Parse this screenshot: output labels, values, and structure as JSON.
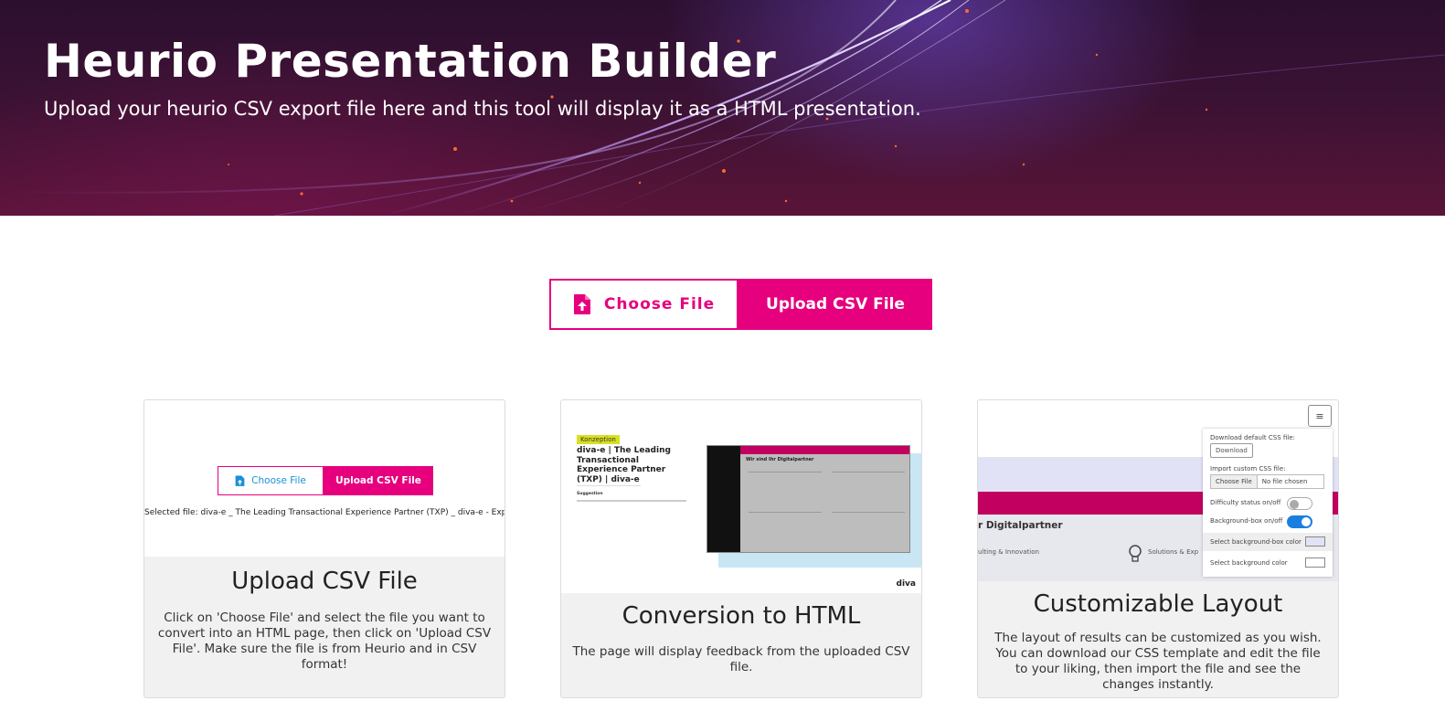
{
  "hero": {
    "title": "Heurio Presentation Builder",
    "subtitle": "Upload your heurio CSV export file here and this tool will display it as a HTML presentation."
  },
  "upload": {
    "choose_label": "Choose File",
    "upload_label": "Upload CSV File",
    "icon": "file-upload-icon"
  },
  "cards": [
    {
      "title": "Upload CSV File",
      "text": "Click on 'Choose File' and select the file you want to convert into an HTML page, then click on 'Upload CSV File'. Make sure the file is from Heurio and in CSV format!",
      "preview": {
        "choose_label": "Choose File",
        "upload_label": "Upload CSV File",
        "selected_file": "Selected file: diva-e _ The Leading Transactional Experience Partner (TXP) _ diva-e - Export.csv"
      }
    },
    {
      "title": "Conversion to HTML",
      "text": "The page will display feedback from the uploaded CSV file.",
      "preview": {
        "tag": "Konzeption",
        "doc_title": "diva-e | The Leading Transactional Experience Partner (TXP) | diva-e",
        "suggestion": "Suggestion",
        "slide_heading": "Wir sind Ihr Digitalpartner",
        "logo": "diva"
      }
    },
    {
      "title": "Customizable Layout",
      "text": "The layout of results can be customized as you wish. You can download our CSS template and edit the file to your liking, then import the file and see the changes instantly.",
      "preview": {
        "heading": "r Digitalpartner",
        "sub1": "ulting & Innovation",
        "sub2": "Solutions & Exp",
        "download_css_label": "Download default CSS file:",
        "download_button": "Download",
        "import_css_label": "Import custom CSS file:",
        "choose_file": "Choose File",
        "no_file": "No file chosen",
        "difficulty_label": "Difficulty status on/off",
        "bgbox_label": "Background-box on/off",
        "bgbox_color_label": "Select background-box color",
        "bg_color_label": "Select background color"
      }
    }
  ],
  "colors": {
    "accent": "#e6007e",
    "link_blue": "#1a8ed6"
  }
}
